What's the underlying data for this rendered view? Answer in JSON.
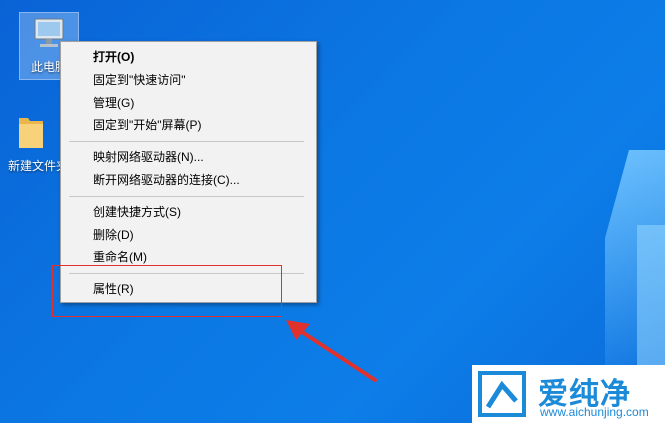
{
  "desktop": {
    "icons": [
      {
        "label": "此电脑"
      },
      {
        "label": "新建文件夹"
      }
    ]
  },
  "context_menu": {
    "groups": [
      [
        {
          "label": "打开(O)",
          "bold": true
        },
        {
          "label": "固定到\"快速访问\""
        },
        {
          "label": "管理(G)"
        },
        {
          "label": "固定到\"开始\"屏幕(P)"
        }
      ],
      [
        {
          "label": "映射网络驱动器(N)..."
        },
        {
          "label": "断开网络驱动器的连接(C)..."
        }
      ],
      [
        {
          "label": "创建快捷方式(S)"
        },
        {
          "label": "删除(D)"
        },
        {
          "label": "重命名(M)"
        }
      ],
      [
        {
          "label": "属性(R)"
        }
      ]
    ]
  },
  "annotation": {
    "color": "#e0312c"
  },
  "watermark": {
    "brand": "爱纯净",
    "url": "www.aichunjing.com",
    "color": "#1b8ad8"
  }
}
